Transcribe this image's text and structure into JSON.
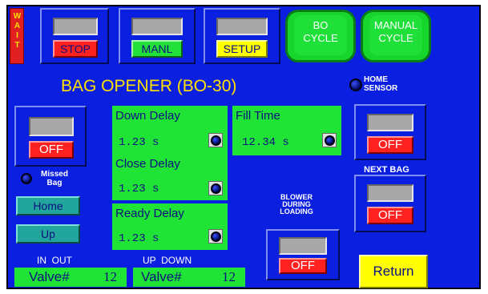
{
  "wait_tab": {
    "label": "WAIT"
  },
  "top_buttons": {
    "stop": {
      "label": "STOP"
    },
    "manl": {
      "label": "MANL"
    },
    "setup": {
      "label": "SETUP"
    },
    "bo_cycle": {
      "line1": "BO",
      "line2": "CYCLE"
    },
    "manual_cycle": {
      "line1": "MANUAL",
      "line2": "CYCLE"
    }
  },
  "title": "BAG OPENER (BO-30)",
  "home_sensor": {
    "line1": "HOME",
    "line2": "SENSOR"
  },
  "left_off": {
    "label": "OFF"
  },
  "missed_bag": {
    "line1": "Missed",
    "line2": "Bag"
  },
  "nav": {
    "home": "Home",
    "up": "Up"
  },
  "delays": {
    "down_delay": {
      "title": "Down Delay",
      "value": "1.23 s"
    },
    "close_delay": {
      "title": "Close Delay",
      "value": "1.23 s"
    },
    "ready_delay": {
      "title": "Ready Delay",
      "value": "1.23 s"
    },
    "fill_time": {
      "title": "Fill Time",
      "value": "12.34 s"
    }
  },
  "right_off1": {
    "label": "OFF"
  },
  "next_bag": {
    "label": "NEXT BAG",
    "state": "OFF"
  },
  "blower": {
    "line1": "BLOWER",
    "line2": "DURING",
    "line3": "LOADING",
    "state": "OFF"
  },
  "valves": {
    "in_out_label": "IN  OUT",
    "up_down_label": "UP  DOWN",
    "valve1": {
      "label": "Valve#",
      "number": "12"
    },
    "valve2": {
      "label": "Valve#",
      "number": "12"
    }
  },
  "return_button": {
    "label": "Return"
  },
  "colors": {
    "panel": "#0b1fe0",
    "green": "#1fe335",
    "red": "#ff2020",
    "yellow": "#ffff00",
    "title_yellow": "#ffe000"
  }
}
